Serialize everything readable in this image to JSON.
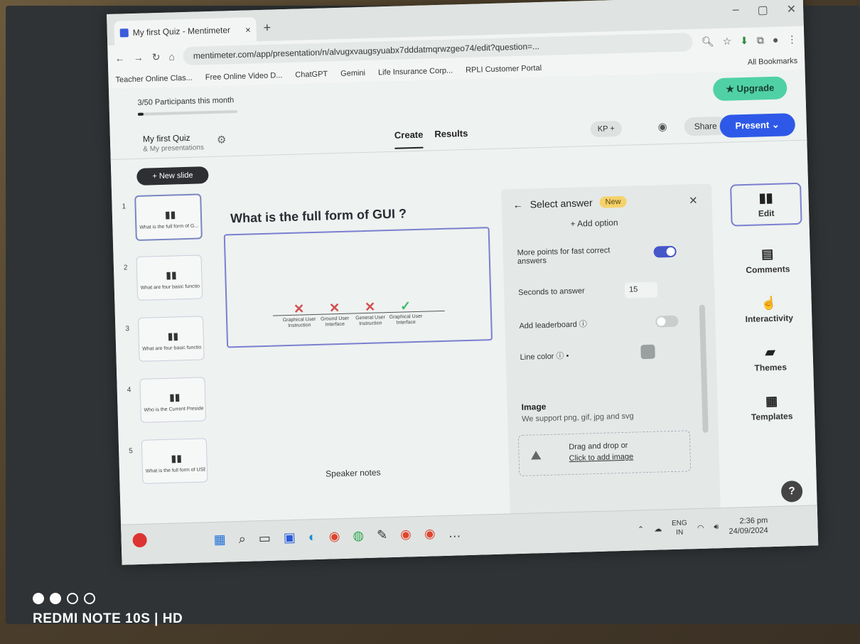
{
  "browser": {
    "tab_title": "My first Quiz - Mentimeter",
    "url": "mentimeter.com/app/presentation/n/alvugxvaugsyuabx7dddatmqrwzgeo74/edit?question=...",
    "bookmarks": [
      "Teacher Online Clas...",
      "Free Online Video D...",
      "ChatGPT",
      "Gemini",
      "Life Insurance Corp...",
      "RPLI Customer Portal"
    ],
    "all_bookmarks": "All Bookmarks"
  },
  "header": {
    "participants": "3/50 Participants this month",
    "upgrade": "Upgrade",
    "quiz_title": "My first Quiz",
    "quiz_sub": "& My presentations",
    "tab_create": "Create",
    "tab_results": "Results",
    "kp": "KP +",
    "share": "Share",
    "present": "Present"
  },
  "left": {
    "new_slide": "+ New slide",
    "slides": [
      {
        "num": "1",
        "title": "What is the full form of G..."
      },
      {
        "num": "2",
        "title": "What are four basic functio..."
      },
      {
        "num": "3",
        "title": "What are four basic functio..."
      },
      {
        "num": "4",
        "title": "Who is the Current Preside..."
      },
      {
        "num": "5",
        "title": "What is the full form of USB"
      }
    ]
  },
  "canvas": {
    "question": "What is the full form of GUI ?",
    "options": [
      {
        "label": "Graphical User Instruction",
        "correct": false
      },
      {
        "label": "Ground User Interface",
        "correct": false
      },
      {
        "label": "General User Instruction",
        "correct": false
      },
      {
        "label": "Graphical User Interface",
        "correct": true
      }
    ],
    "speaker_notes": "Speaker notes"
  },
  "panel": {
    "title": "Select answer",
    "badge": "New",
    "add_option": "+ Add option",
    "fast_points": "More points for fast correct answers",
    "seconds_label": "Seconds to answer",
    "seconds_value": "15",
    "leaderboard": "Add leaderboard",
    "line_color": "Line color",
    "image_title": "Image",
    "image_sub": "We support png, gif, jpg and svg",
    "drop_1": "Drag and drop or",
    "drop_2": "Click to add image"
  },
  "rail": {
    "edit": "Edit",
    "comments": "Comments",
    "interactivity": "Interactivity",
    "themes": "Themes",
    "templates": "Templates"
  },
  "taskbar": {
    "lang_1": "ENG",
    "lang_2": "IN",
    "time": "2:36 pm",
    "date": "24/09/2024"
  },
  "camera": {
    "watermark": "REDMI NOTE 10S | HD"
  }
}
